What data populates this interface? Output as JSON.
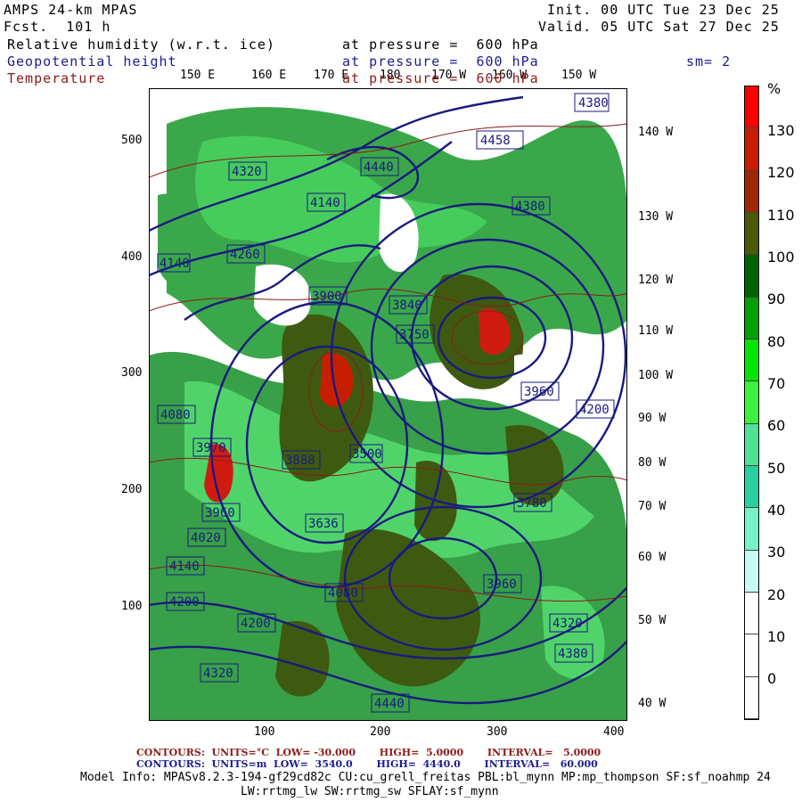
{
  "header": {
    "model": "AMPS 24-km MPAS",
    "fcst": "Fcst.  101 h",
    "init": "Init. 00 UTC Tue 23 Dec 25",
    "valid": "Valid. 05 UTC Sat 27 Dec 25",
    "fields": [
      {
        "name": "Relative humidity (w.r.t. ice)",
        "level": "at pressure =  600 hPa",
        "color": "#000000"
      },
      {
        "name": "Geopotential height",
        "level": "at pressure =  600 hPa",
        "color": "#1c1c8c"
      },
      {
        "name": "Temperature",
        "level": "at pressure =  600 hPa",
        "color": "#8b1a1a"
      }
    ],
    "smoothing": "sm= 2"
  },
  "top_longitudes": [
    "150 E",
    "160 E",
    "170 E",
    "180",
    "170 W",
    "160 W",
    "150 W"
  ],
  "right_longitudes": [
    "140 W",
    "130 W",
    "120 W",
    "110 W",
    "100 W",
    "90 W",
    "80 W",
    "70 W",
    "60 W",
    "50 W",
    "40 W"
  ],
  "x_ticks": [
    "100",
    "200",
    "300",
    "400"
  ],
  "y_ticks": [
    "500",
    "400",
    "300",
    "200",
    "100"
  ],
  "colorbar": {
    "unit": "%",
    "labels": [
      "130",
      "120",
      "110",
      "100",
      "90",
      "80",
      "70",
      "60",
      "50",
      "40",
      "30",
      "20",
      "10",
      "0"
    ],
    "colors": [
      "#ff0000",
      "#c81e00",
      "#a02800",
      "#4a5a08",
      "#006400",
      "#00a000",
      "#00e600",
      "#3cf03c",
      "#50e096",
      "#28d2a0",
      "#78f0c8",
      "#c8faf0",
      "#ffffff",
      "#ffffff",
      "#ffffff"
    ]
  },
  "height_labels": [
    "4380",
    "4458",
    "4440",
    "4320",
    "4140",
    "4380",
    "4260",
    "4140",
    "3900",
    "3840",
    "3750",
    "3960",
    "4200",
    "4080",
    "3970",
    "3888",
    "3500",
    "3636",
    "3780",
    "3960",
    "4020",
    "4140",
    "4200",
    "4080",
    "3960",
    "4320",
    "4320",
    "4200",
    "4380",
    "4440"
  ],
  "footer": {
    "contours_temp": "CONTOURS:  UNITS=°C  LOW= -30.000       HIGH=  5.0000       INTERVAL=   5.0000",
    "contours_height": "CONTOURS:  UNITS=m  LOW=  3540.0       HIGH=  4440.0       INTERVAL=   60.000",
    "model_info": "Model Info: MPASv8.2.3-194-gf29cd82c CU:cu_grell_freitas PBL:bl_mynn MP:mp_thompson SF:sf_noahmp 24",
    "model_info2": "LW:rrtmg_lw SW:rrtmg_sw SFLAY:sf_mynn"
  }
}
